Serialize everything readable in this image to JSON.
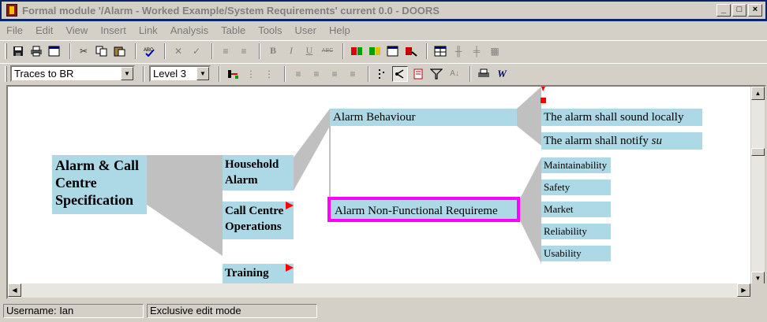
{
  "window": {
    "title": "Formal module '/Alarm - Worked Example/System Requirements' current 0.0 - DOORS",
    "controls": [
      "_",
      "□",
      "×"
    ]
  },
  "menu": [
    "File",
    "Edit",
    "View",
    "Insert",
    "Link",
    "Analysis",
    "Table",
    "Tools",
    "User",
    "Help"
  ],
  "toolbar": {
    "view_select": "Traces to BR",
    "level_select": "Level 3"
  },
  "tree": {
    "root": "Alarm & Call Centre Specification",
    "household": "Household Alarm",
    "call_centre": "Call Centre Operations",
    "training": "Training",
    "behaviour": "Alarm Behaviour",
    "non_functional": "Alarm Non-Functional Requireme",
    "sound_locally": "The alarm shall sound locally",
    "notify_prefix": "The alarm shall notify ",
    "notify_italic": "su",
    "maintainability": "Maintainability",
    "safety": "Safety",
    "market": "Market",
    "reliability": "Reliability",
    "usability": "Usability"
  },
  "colors": {
    "node_fill": "#add8e6",
    "connector": "#c0c0c0",
    "selection": "#ff00ff",
    "link_marker": "#ff0000"
  },
  "status": {
    "user": "Username: Ian",
    "mode": "Exclusive edit mode"
  }
}
